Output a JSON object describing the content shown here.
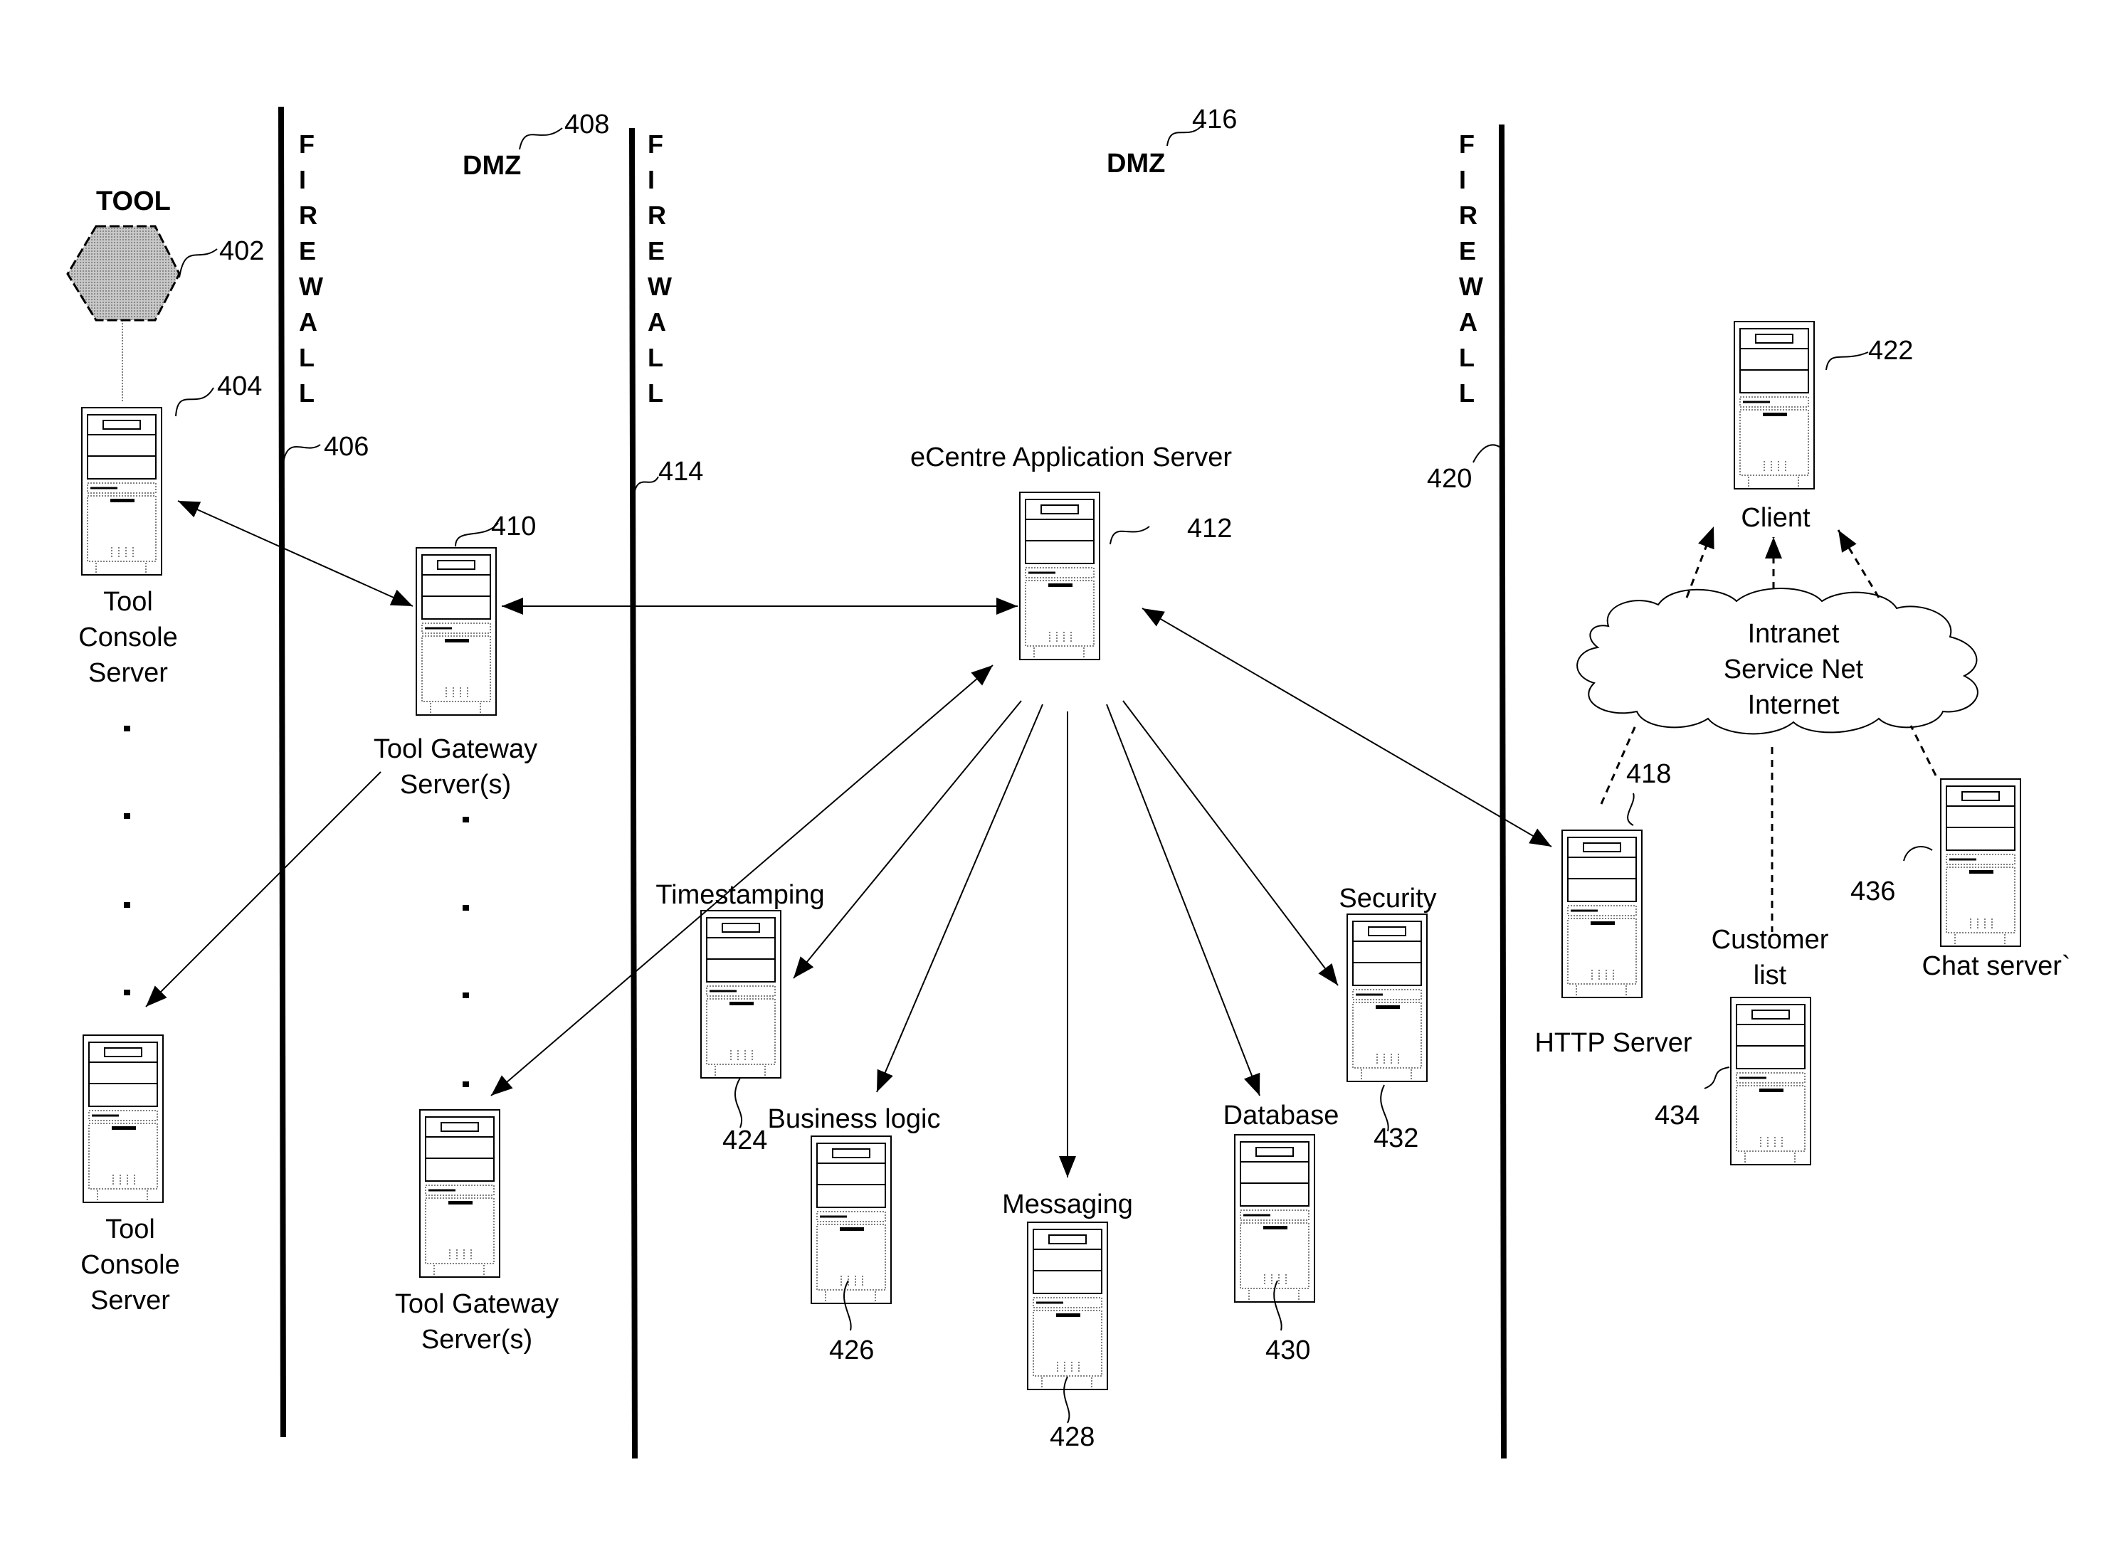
{
  "firewalls": [
    {
      "letters": [
        "F",
        "I",
        "R",
        "E",
        "W",
        "A",
        "L",
        "L"
      ],
      "ref": "406"
    },
    {
      "letters": [
        "F",
        "I",
        "R",
        "E",
        "W",
        "A",
        "L",
        "L"
      ],
      "ref": "414"
    },
    {
      "letters": [
        "F",
        "I",
        "R",
        "E",
        "W",
        "A",
        "L",
        "L"
      ],
      "ref": "420"
    }
  ],
  "zones": [
    {
      "label": "DMZ",
      "ref": "408"
    },
    {
      "label": "DMZ",
      "ref": "416"
    }
  ],
  "tool": {
    "label": "TOOL",
    "ref": "402"
  },
  "nodes": {
    "tool_console_top": {
      "label_lines": [
        "Tool",
        "Console",
        "Server"
      ],
      "ref": "404"
    },
    "tool_console_bottom": {
      "label_lines": [
        "Tool",
        "Console",
        "Server"
      ]
    },
    "tool_gateway_top": {
      "label_lines": [
        "Tool Gateway",
        "Server(s)"
      ],
      "ref": "410"
    },
    "tool_gateway_bottom": {
      "label_lines": [
        "Tool Gateway",
        "Server(s)"
      ]
    },
    "app_server": {
      "label": "eCentre Application Server",
      "ref": "412"
    },
    "timestamping": {
      "label": "Timestamping",
      "ref": "424"
    },
    "business_logic": {
      "label": "Business logic",
      "ref": "426"
    },
    "messaging": {
      "label": "Messaging",
      "ref": "428"
    },
    "database": {
      "label": "Database",
      "ref": "430"
    },
    "security": {
      "label": "Security",
      "ref": "432"
    },
    "http_server": {
      "label": "HTTP Server",
      "ref": "418"
    },
    "client": {
      "label": "Client",
      "ref": "422"
    },
    "customer_list": {
      "label_lines": [
        "Customer",
        "list"
      ],
      "ref": "434"
    },
    "chat_server": {
      "label": "Chat server`",
      "ref": "436"
    }
  },
  "network_cloud": {
    "lines": [
      "Intranet",
      "Service Net",
      "Internet"
    ]
  },
  "colors": {
    "ink": "#000000",
    "background": "#ffffff",
    "tool_fill": "#a8a8a8"
  }
}
